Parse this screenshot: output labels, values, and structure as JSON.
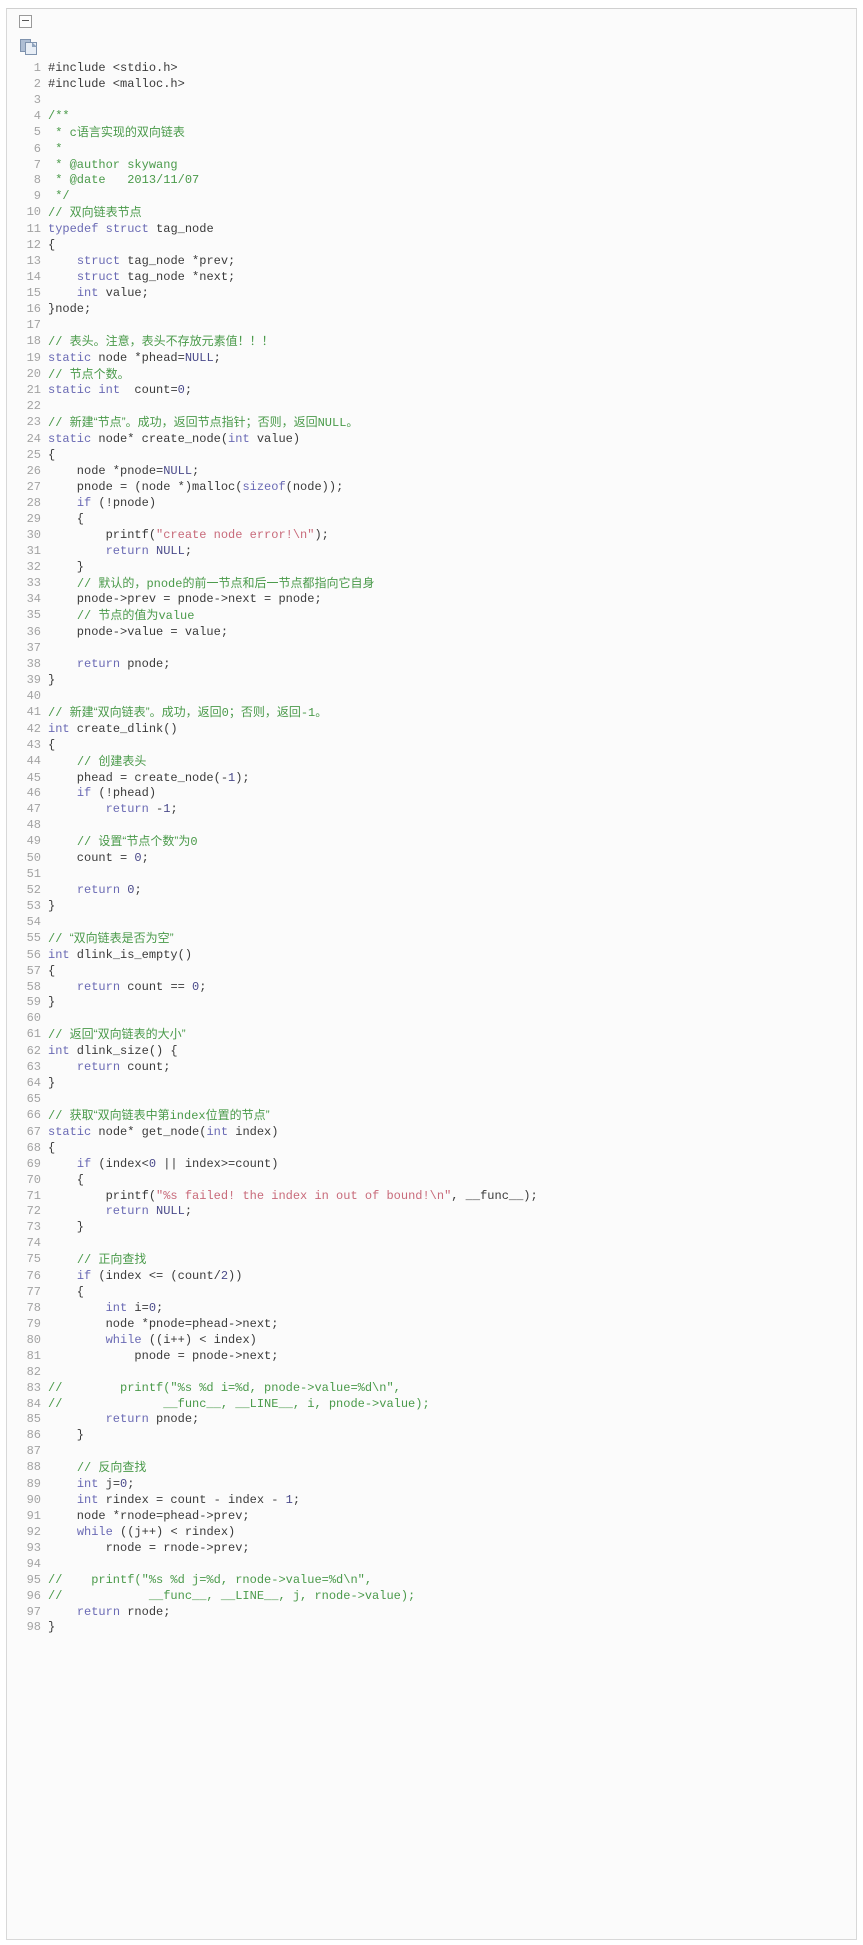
{
  "toolbar": {
    "collapse_toggle_label": "-",
    "collapse_icon": "minus-box-icon",
    "copy_icon": "copy-icon"
  },
  "editor": {
    "language": "c",
    "first_line": 1,
    "last_line": 98,
    "colors": {
      "background": "#fbfbfb",
      "border": "#d8d8d8",
      "line_number": "#a3a3a3",
      "plain_text": "#3a3a3a",
      "comment": "#4a9a4a",
      "keyword": "#6a6ab4",
      "string": "#c86a7a",
      "constant": "#4a4a8a"
    }
  },
  "code_lines": [
    {
      "n": 1,
      "tokens": [
        {
          "t": "pl",
          "v": "#include <stdio.h>"
        }
      ]
    },
    {
      "n": 2,
      "tokens": [
        {
          "t": "pl",
          "v": "#include <malloc.h>"
        }
      ]
    },
    {
      "n": 3,
      "tokens": []
    },
    {
      "n": 4,
      "tokens": [
        {
          "t": "cm",
          "v": "/**"
        }
      ]
    },
    {
      "n": 5,
      "tokens": [
        {
          "t": "cm",
          "v": " * "
        },
        {
          "t": "cm",
          "v": "c"
        },
        {
          "t": "cmn",
          "v": "语言实现的双向链表"
        }
      ]
    },
    {
      "n": 6,
      "tokens": [
        {
          "t": "cm",
          "v": " *"
        }
      ]
    },
    {
      "n": 7,
      "tokens": [
        {
          "t": "cm",
          "v": " * @author skywang"
        }
      ]
    },
    {
      "n": 8,
      "tokens": [
        {
          "t": "cm",
          "v": " * @date   2013/11/07"
        }
      ]
    },
    {
      "n": 9,
      "tokens": [
        {
          "t": "cm",
          "v": " */"
        }
      ]
    },
    {
      "n": 10,
      "tokens": [
        {
          "t": "cm",
          "v": "// "
        },
        {
          "t": "cmn",
          "v": "双向链表节点"
        }
      ]
    },
    {
      "n": 11,
      "tokens": [
        {
          "t": "kw",
          "v": "typedef"
        },
        {
          "t": "pl",
          "v": " "
        },
        {
          "t": "kw",
          "v": "struct"
        },
        {
          "t": "pl",
          "v": " tag_node"
        }
      ]
    },
    {
      "n": 12,
      "tokens": [
        {
          "t": "pl",
          "v": "{"
        }
      ]
    },
    {
      "n": 13,
      "tokens": [
        {
          "t": "pl",
          "v": "    "
        },
        {
          "t": "kw",
          "v": "struct"
        },
        {
          "t": "pl",
          "v": " tag_node *prev;"
        }
      ]
    },
    {
      "n": 14,
      "tokens": [
        {
          "t": "pl",
          "v": "    "
        },
        {
          "t": "kw",
          "v": "struct"
        },
        {
          "t": "pl",
          "v": " tag_node *next;"
        }
      ]
    },
    {
      "n": 15,
      "tokens": [
        {
          "t": "pl",
          "v": "    "
        },
        {
          "t": "kw",
          "v": "int"
        },
        {
          "t": "pl",
          "v": " value;"
        }
      ]
    },
    {
      "n": 16,
      "tokens": [
        {
          "t": "pl",
          "v": "}node;"
        }
      ]
    },
    {
      "n": 17,
      "tokens": []
    },
    {
      "n": 18,
      "tokens": [
        {
          "t": "cm",
          "v": "// "
        },
        {
          "t": "cmn",
          "v": "表头。注意，表头不存放元素值！！！"
        }
      ]
    },
    {
      "n": 19,
      "tokens": [
        {
          "t": "kw",
          "v": "static"
        },
        {
          "t": "pl",
          "v": " node *phead="
        },
        {
          "t": "num",
          "v": "NULL"
        },
        {
          "t": "pl",
          "v": ";"
        }
      ]
    },
    {
      "n": 20,
      "tokens": [
        {
          "t": "cm",
          "v": "// "
        },
        {
          "t": "cmn",
          "v": "节点个数。"
        }
      ]
    },
    {
      "n": 21,
      "tokens": [
        {
          "t": "kw",
          "v": "static"
        },
        {
          "t": "pl",
          "v": " "
        },
        {
          "t": "kw",
          "v": "int"
        },
        {
          "t": "pl",
          "v": "  count="
        },
        {
          "t": "num",
          "v": "0"
        },
        {
          "t": "pl",
          "v": ";"
        }
      ]
    },
    {
      "n": 22,
      "tokens": []
    },
    {
      "n": 23,
      "tokens": [
        {
          "t": "cm",
          "v": "// "
        },
        {
          "t": "cmn",
          "v": "新建“节点”。成功，返回节点指针；否则，返回"
        },
        {
          "t": "cm",
          "v": "NULL"
        },
        {
          "t": "cmn",
          "v": "。"
        }
      ]
    },
    {
      "n": 24,
      "tokens": [
        {
          "t": "kw",
          "v": "static"
        },
        {
          "t": "pl",
          "v": " node* create_node("
        },
        {
          "t": "kw",
          "v": "int"
        },
        {
          "t": "pl",
          "v": " value)"
        }
      ]
    },
    {
      "n": 25,
      "tokens": [
        {
          "t": "pl",
          "v": "{"
        }
      ]
    },
    {
      "n": 26,
      "tokens": [
        {
          "t": "pl",
          "v": "    node *pnode="
        },
        {
          "t": "num",
          "v": "NULL"
        },
        {
          "t": "pl",
          "v": ";"
        }
      ]
    },
    {
      "n": 27,
      "tokens": [
        {
          "t": "pl",
          "v": "    pnode = (node *)malloc("
        },
        {
          "t": "kw",
          "v": "sizeof"
        },
        {
          "t": "pl",
          "v": "(node));"
        }
      ]
    },
    {
      "n": 28,
      "tokens": [
        {
          "t": "pl",
          "v": "    "
        },
        {
          "t": "kw",
          "v": "if"
        },
        {
          "t": "pl",
          "v": " (!pnode)"
        }
      ]
    },
    {
      "n": 29,
      "tokens": [
        {
          "t": "pl",
          "v": "    {"
        }
      ]
    },
    {
      "n": 30,
      "tokens": [
        {
          "t": "pl",
          "v": "        printf("
        },
        {
          "t": "str",
          "v": "\"create node error!\\n\""
        },
        {
          "t": "pl",
          "v": ");"
        }
      ]
    },
    {
      "n": 31,
      "tokens": [
        {
          "t": "pl",
          "v": "        "
        },
        {
          "t": "kw",
          "v": "return"
        },
        {
          "t": "pl",
          "v": " "
        },
        {
          "t": "num",
          "v": "NULL"
        },
        {
          "t": "pl",
          "v": ";"
        }
      ]
    },
    {
      "n": 32,
      "tokens": [
        {
          "t": "pl",
          "v": "    }"
        }
      ]
    },
    {
      "n": 33,
      "tokens": [
        {
          "t": "pl",
          "v": "    "
        },
        {
          "t": "cm",
          "v": "// "
        },
        {
          "t": "cmn",
          "v": "默认的，"
        },
        {
          "t": "cm",
          "v": "pnode"
        },
        {
          "t": "cmn",
          "v": "的前一节点和后一节点都指向它自身"
        }
      ]
    },
    {
      "n": 34,
      "tokens": [
        {
          "t": "pl",
          "v": "    pnode->prev = pnode->next = pnode;"
        }
      ]
    },
    {
      "n": 35,
      "tokens": [
        {
          "t": "pl",
          "v": "    "
        },
        {
          "t": "cm",
          "v": "// "
        },
        {
          "t": "cmn",
          "v": "节点的值为"
        },
        {
          "t": "cm",
          "v": "value"
        }
      ]
    },
    {
      "n": 36,
      "tokens": [
        {
          "t": "pl",
          "v": "    pnode->value = value;"
        }
      ]
    },
    {
      "n": 37,
      "tokens": []
    },
    {
      "n": 38,
      "tokens": [
        {
          "t": "pl",
          "v": "    "
        },
        {
          "t": "kw",
          "v": "return"
        },
        {
          "t": "pl",
          "v": " pnode;"
        }
      ]
    },
    {
      "n": 39,
      "tokens": [
        {
          "t": "pl",
          "v": "}"
        }
      ]
    },
    {
      "n": 40,
      "tokens": []
    },
    {
      "n": 41,
      "tokens": [
        {
          "t": "cm",
          "v": "// "
        },
        {
          "t": "cmn",
          "v": "新建“双向链表”。成功，返回"
        },
        {
          "t": "cm",
          "v": "0"
        },
        {
          "t": "cmn",
          "v": "；否则，返回"
        },
        {
          "t": "cm",
          "v": "-1"
        },
        {
          "t": "cmn",
          "v": "。"
        }
      ]
    },
    {
      "n": 42,
      "tokens": [
        {
          "t": "kw",
          "v": "int"
        },
        {
          "t": "pl",
          "v": " create_dlink()"
        }
      ]
    },
    {
      "n": 43,
      "tokens": [
        {
          "t": "pl",
          "v": "{"
        }
      ]
    },
    {
      "n": 44,
      "tokens": [
        {
          "t": "pl",
          "v": "    "
        },
        {
          "t": "cm",
          "v": "// "
        },
        {
          "t": "cmn",
          "v": "创建表头"
        }
      ]
    },
    {
      "n": 45,
      "tokens": [
        {
          "t": "pl",
          "v": "    phead = create_node(-"
        },
        {
          "t": "num",
          "v": "1"
        },
        {
          "t": "pl",
          "v": ");"
        }
      ]
    },
    {
      "n": 46,
      "tokens": [
        {
          "t": "pl",
          "v": "    "
        },
        {
          "t": "kw",
          "v": "if"
        },
        {
          "t": "pl",
          "v": " (!phead)"
        }
      ]
    },
    {
      "n": 47,
      "tokens": [
        {
          "t": "pl",
          "v": "        "
        },
        {
          "t": "kw",
          "v": "return"
        },
        {
          "t": "pl",
          "v": " -"
        },
        {
          "t": "num",
          "v": "1"
        },
        {
          "t": "pl",
          "v": ";"
        }
      ]
    },
    {
      "n": 48,
      "tokens": []
    },
    {
      "n": 49,
      "tokens": [
        {
          "t": "pl",
          "v": "    "
        },
        {
          "t": "cm",
          "v": "// "
        },
        {
          "t": "cmn",
          "v": "设置“节点个数”为"
        },
        {
          "t": "cm",
          "v": "0"
        }
      ]
    },
    {
      "n": 50,
      "tokens": [
        {
          "t": "pl",
          "v": "    count = "
        },
        {
          "t": "num",
          "v": "0"
        },
        {
          "t": "pl",
          "v": ";"
        }
      ]
    },
    {
      "n": 51,
      "tokens": []
    },
    {
      "n": 52,
      "tokens": [
        {
          "t": "pl",
          "v": "    "
        },
        {
          "t": "kw",
          "v": "return"
        },
        {
          "t": "pl",
          "v": " "
        },
        {
          "t": "num",
          "v": "0"
        },
        {
          "t": "pl",
          "v": ";"
        }
      ]
    },
    {
      "n": 53,
      "tokens": [
        {
          "t": "pl",
          "v": "}"
        }
      ]
    },
    {
      "n": 54,
      "tokens": []
    },
    {
      "n": 55,
      "tokens": [
        {
          "t": "cm",
          "v": "// "
        },
        {
          "t": "cmn",
          "v": "“双向链表是否为空”"
        }
      ]
    },
    {
      "n": 56,
      "tokens": [
        {
          "t": "kw",
          "v": "int"
        },
        {
          "t": "pl",
          "v": " dlink_is_empty()"
        }
      ]
    },
    {
      "n": 57,
      "tokens": [
        {
          "t": "pl",
          "v": "{"
        }
      ]
    },
    {
      "n": 58,
      "tokens": [
        {
          "t": "pl",
          "v": "    "
        },
        {
          "t": "kw",
          "v": "return"
        },
        {
          "t": "pl",
          "v": " count == "
        },
        {
          "t": "num",
          "v": "0"
        },
        {
          "t": "pl",
          "v": ";"
        }
      ]
    },
    {
      "n": 59,
      "tokens": [
        {
          "t": "pl",
          "v": "}"
        }
      ]
    },
    {
      "n": 60,
      "tokens": []
    },
    {
      "n": 61,
      "tokens": [
        {
          "t": "cm",
          "v": "// "
        },
        {
          "t": "cmn",
          "v": "返回“双向链表的大小”"
        }
      ]
    },
    {
      "n": 62,
      "tokens": [
        {
          "t": "kw",
          "v": "int"
        },
        {
          "t": "pl",
          "v": " dlink_size() {"
        }
      ]
    },
    {
      "n": 63,
      "tokens": [
        {
          "t": "pl",
          "v": "    "
        },
        {
          "t": "kw",
          "v": "return"
        },
        {
          "t": "pl",
          "v": " count;"
        }
      ]
    },
    {
      "n": 64,
      "tokens": [
        {
          "t": "pl",
          "v": "}"
        }
      ]
    },
    {
      "n": 65,
      "tokens": []
    },
    {
      "n": 66,
      "tokens": [
        {
          "t": "cm",
          "v": "// "
        },
        {
          "t": "cmn",
          "v": "获取“双向链表中第"
        },
        {
          "t": "cm",
          "v": "index"
        },
        {
          "t": "cmn",
          "v": "位置的节点”"
        }
      ]
    },
    {
      "n": 67,
      "tokens": [
        {
          "t": "kw",
          "v": "static"
        },
        {
          "t": "pl",
          "v": " node* get_node("
        },
        {
          "t": "kw",
          "v": "int"
        },
        {
          "t": "pl",
          "v": " index)"
        }
      ]
    },
    {
      "n": 68,
      "tokens": [
        {
          "t": "pl",
          "v": "{"
        }
      ]
    },
    {
      "n": 69,
      "tokens": [
        {
          "t": "pl",
          "v": "    "
        },
        {
          "t": "kw",
          "v": "if"
        },
        {
          "t": "pl",
          "v": " (index<"
        },
        {
          "t": "num",
          "v": "0"
        },
        {
          "t": "pl",
          "v": " || index>=count)"
        }
      ]
    },
    {
      "n": 70,
      "tokens": [
        {
          "t": "pl",
          "v": "    {"
        }
      ]
    },
    {
      "n": 71,
      "tokens": [
        {
          "t": "pl",
          "v": "        printf("
        },
        {
          "t": "str",
          "v": "\"%s failed! the index in out of bound!\\n\""
        },
        {
          "t": "pl",
          "v": ", __func__);"
        }
      ]
    },
    {
      "n": 72,
      "tokens": [
        {
          "t": "pl",
          "v": "        "
        },
        {
          "t": "kw",
          "v": "return"
        },
        {
          "t": "pl",
          "v": " "
        },
        {
          "t": "num",
          "v": "NULL"
        },
        {
          "t": "pl",
          "v": ";"
        }
      ]
    },
    {
      "n": 73,
      "tokens": [
        {
          "t": "pl",
          "v": "    }"
        }
      ]
    },
    {
      "n": 74,
      "tokens": []
    },
    {
      "n": 75,
      "tokens": [
        {
          "t": "pl",
          "v": "    "
        },
        {
          "t": "cm",
          "v": "// "
        },
        {
          "t": "cmn",
          "v": "正向查找"
        }
      ]
    },
    {
      "n": 76,
      "tokens": [
        {
          "t": "pl",
          "v": "    "
        },
        {
          "t": "kw",
          "v": "if"
        },
        {
          "t": "pl",
          "v": " (index <= (count/"
        },
        {
          "t": "num",
          "v": "2"
        },
        {
          "t": "pl",
          "v": "))"
        }
      ]
    },
    {
      "n": 77,
      "tokens": [
        {
          "t": "pl",
          "v": "    {"
        }
      ]
    },
    {
      "n": 78,
      "tokens": [
        {
          "t": "pl",
          "v": "        "
        },
        {
          "t": "kw",
          "v": "int"
        },
        {
          "t": "pl",
          "v": " i="
        },
        {
          "t": "num",
          "v": "0"
        },
        {
          "t": "pl",
          "v": ";"
        }
      ]
    },
    {
      "n": 79,
      "tokens": [
        {
          "t": "pl",
          "v": "        node *pnode=phead->next;"
        }
      ]
    },
    {
      "n": 80,
      "tokens": [
        {
          "t": "pl",
          "v": "        "
        },
        {
          "t": "kw",
          "v": "while"
        },
        {
          "t": "pl",
          "v": " ((i++) < index)"
        }
      ]
    },
    {
      "n": 81,
      "tokens": [
        {
          "t": "pl",
          "v": "            pnode = pnode->next;"
        }
      ]
    },
    {
      "n": 82,
      "tokens": []
    },
    {
      "n": 83,
      "tokens": [
        {
          "t": "cm",
          "v": "//        printf(\"%s %d i=%d, pnode->value=%d\\n\","
        }
      ]
    },
    {
      "n": 84,
      "tokens": [
        {
          "t": "cm",
          "v": "//              __func__, __LINE__, i, pnode->value);"
        }
      ]
    },
    {
      "n": 85,
      "tokens": [
        {
          "t": "pl",
          "v": "        "
        },
        {
          "t": "kw",
          "v": "return"
        },
        {
          "t": "pl",
          "v": " pnode;"
        }
      ]
    },
    {
      "n": 86,
      "tokens": [
        {
          "t": "pl",
          "v": "    }"
        }
      ]
    },
    {
      "n": 87,
      "tokens": []
    },
    {
      "n": 88,
      "tokens": [
        {
          "t": "pl",
          "v": "    "
        },
        {
          "t": "cm",
          "v": "// "
        },
        {
          "t": "cmn",
          "v": "反向查找"
        }
      ]
    },
    {
      "n": 89,
      "tokens": [
        {
          "t": "pl",
          "v": "    "
        },
        {
          "t": "kw",
          "v": "int"
        },
        {
          "t": "pl",
          "v": " j="
        },
        {
          "t": "num",
          "v": "0"
        },
        {
          "t": "pl",
          "v": ";"
        }
      ]
    },
    {
      "n": 90,
      "tokens": [
        {
          "t": "pl",
          "v": "    "
        },
        {
          "t": "kw",
          "v": "int"
        },
        {
          "t": "pl",
          "v": " rindex = count - index - "
        },
        {
          "t": "num",
          "v": "1"
        },
        {
          "t": "pl",
          "v": ";"
        }
      ]
    },
    {
      "n": 91,
      "tokens": [
        {
          "t": "pl",
          "v": "    node *rnode=phead->prev;"
        }
      ]
    },
    {
      "n": 92,
      "tokens": [
        {
          "t": "pl",
          "v": "    "
        },
        {
          "t": "kw",
          "v": "while"
        },
        {
          "t": "pl",
          "v": " ((j++) < rindex)"
        }
      ]
    },
    {
      "n": 93,
      "tokens": [
        {
          "t": "pl",
          "v": "        rnode = rnode->prev;"
        }
      ]
    },
    {
      "n": 94,
      "tokens": []
    },
    {
      "n": 95,
      "tokens": [
        {
          "t": "cm",
          "v": "//    printf(\"%s %d j=%d, rnode->value=%d\\n\","
        }
      ]
    },
    {
      "n": 96,
      "tokens": [
        {
          "t": "cm",
          "v": "//            __func__, __LINE__, j, rnode->value);"
        }
      ]
    },
    {
      "n": 97,
      "tokens": [
        {
          "t": "pl",
          "v": "    "
        },
        {
          "t": "kw",
          "v": "return"
        },
        {
          "t": "pl",
          "v": " rnode;"
        }
      ]
    },
    {
      "n": 98,
      "tokens": [
        {
          "t": "pl",
          "v": "}"
        }
      ]
    }
  ]
}
